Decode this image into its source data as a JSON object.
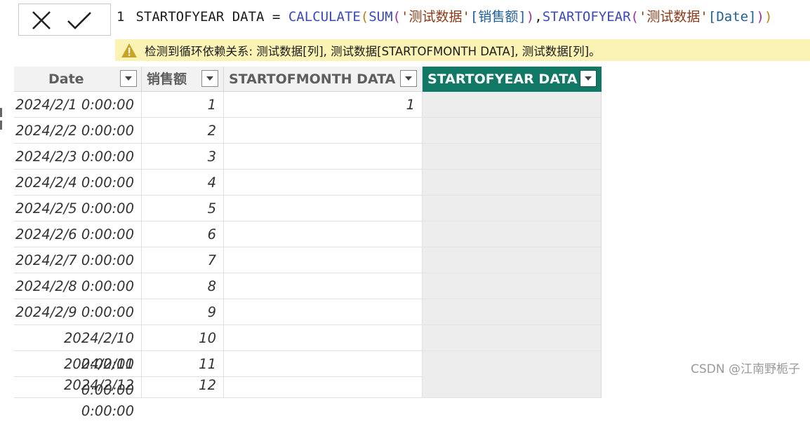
{
  "formula_bar": {
    "line_number": "1",
    "measure_name": "STARTOFYEAR DATA",
    "equals": " = ",
    "fn_calculate": "CALCULATE",
    "fn_sum": "SUM",
    "table_name": "'测试数据'",
    "col_sales": "[销售额]",
    "comma": ",",
    "fn_startofyear": "STARTOFYEAR",
    "col_date": "[Date]",
    "open_paren": "(",
    "close_paren": ")"
  },
  "warning": {
    "message": "检测到循环依赖关系: 测试数据[列], 测试数据[STARTOFMONTH DATA], 测试数据[列]。"
  },
  "table": {
    "columns": [
      {
        "label": "Date"
      },
      {
        "label": "销售额"
      },
      {
        "label": "STARTOFMONTH DATA"
      },
      {
        "label": "STARTOFYEAR DATA"
      }
    ],
    "rows": [
      {
        "date": "2024/2/1 0:00:00",
        "sales": "1",
        "som": "1",
        "soy": ""
      },
      {
        "date": "2024/2/2 0:00:00",
        "sales": "2",
        "som": "",
        "soy": ""
      },
      {
        "date": "2024/2/3 0:00:00",
        "sales": "3",
        "som": "",
        "soy": ""
      },
      {
        "date": "2024/2/4 0:00:00",
        "sales": "4",
        "som": "",
        "soy": ""
      },
      {
        "date": "2024/2/5 0:00:00",
        "sales": "5",
        "som": "",
        "soy": ""
      },
      {
        "date": "2024/2/6 0:00:00",
        "sales": "6",
        "som": "",
        "soy": ""
      },
      {
        "date": "2024/2/7 0:00:00",
        "sales": "7",
        "som": "",
        "soy": ""
      },
      {
        "date": "2024/2/8 0:00:00",
        "sales": "8",
        "som": "",
        "soy": ""
      },
      {
        "date": "2024/2/9 0:00:00",
        "sales": "9",
        "som": "",
        "soy": ""
      },
      {
        "date": "2024/2/10 0:00:00",
        "sales": "10",
        "som": "",
        "soy": ""
      },
      {
        "date": "2024/2/11 0:00:00",
        "sales": "11",
        "som": "",
        "soy": ""
      },
      {
        "date": "2024/2/12 0:00:00",
        "sales": "12",
        "som": "",
        "soy": ""
      }
    ]
  },
  "watermark": "CSDN @江南野栀子",
  "colors": {
    "active_header": "#117865",
    "warning_bg": "#fbf3b4",
    "warning_icon": "#c9a227"
  }
}
